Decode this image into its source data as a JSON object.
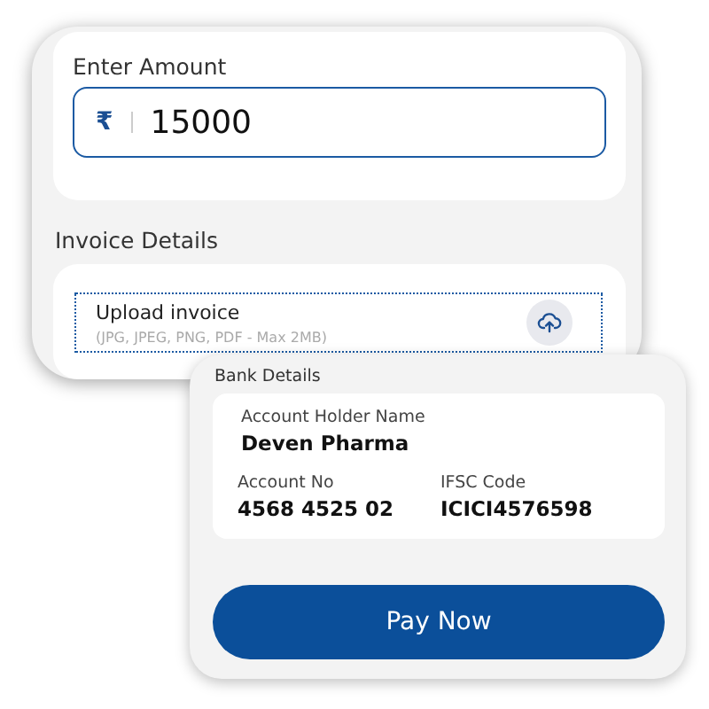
{
  "amount": {
    "label": "Enter Amount",
    "currency": "₹",
    "value": "15000"
  },
  "invoice": {
    "heading": "Invoice Details",
    "upload_title": "Upload invoice",
    "upload_hint": "(JPG, JPEG, PNG, PDF - Max 2MB)"
  },
  "bank": {
    "heading": "Bank Details",
    "fields": [
      {
        "label": "Account Holder Name",
        "value": "Deven Pharma"
      },
      {
        "label": "Account No",
        "value": "4568 4525 02"
      },
      {
        "label": "IFSC Code",
        "value": "ICICI4576598"
      }
    ],
    "button": "Pay Now"
  }
}
